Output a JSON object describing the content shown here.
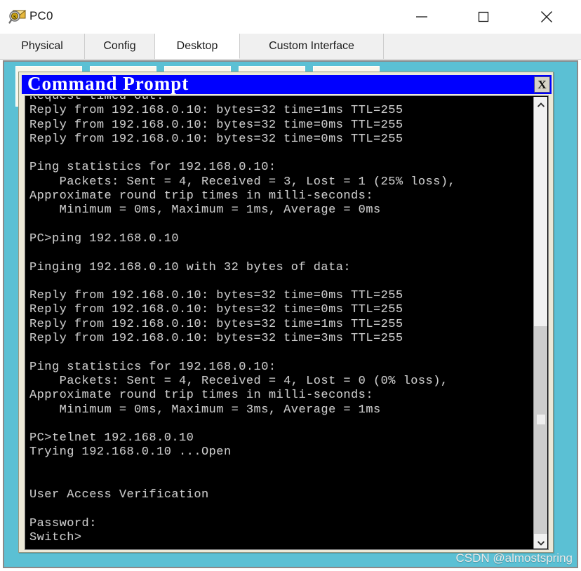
{
  "window": {
    "title": "PC0",
    "icon": "packet-tracer-device-icon",
    "controls": {
      "minimize_label": "—",
      "maximize_label": "□",
      "close_label": "✕"
    }
  },
  "tabs": [
    {
      "id": "physical",
      "label": "Physical",
      "active": false
    },
    {
      "id": "config",
      "label": "Config",
      "active": false
    },
    {
      "id": "desktop",
      "label": "Desktop",
      "active": true
    },
    {
      "id": "custom-interface",
      "label": "Custom Interface",
      "active": false
    }
  ],
  "desktop": {
    "background_color": "#5bc0d4",
    "tile_count": 5
  },
  "command_prompt": {
    "title": "Command Prompt",
    "close_label": "X",
    "titlebar_color": "#0000ff",
    "background_color": "#000000",
    "text_color": "#cccccc",
    "lines": [
      "Request timed out.",
      "Reply from 192.168.0.10: bytes=32 time=1ms TTL=255",
      "Reply from 192.168.0.10: bytes=32 time=0ms TTL=255",
      "Reply from 192.168.0.10: bytes=32 time=0ms TTL=255",
      "",
      "Ping statistics for 192.168.0.10:",
      "    Packets: Sent = 4, Received = 3, Lost = 1 (25% loss),",
      "Approximate round trip times in milli-seconds:",
      "    Minimum = 0ms, Maximum = 1ms, Average = 0ms",
      "",
      "PC>ping 192.168.0.10",
      "",
      "Pinging 192.168.0.10 with 32 bytes of data:",
      "",
      "Reply from 192.168.0.10: bytes=32 time=0ms TTL=255",
      "Reply from 192.168.0.10: bytes=32 time=0ms TTL=255",
      "Reply from 192.168.0.10: bytes=32 time=1ms TTL=255",
      "Reply from 192.168.0.10: bytes=32 time=3ms TTL=255",
      "",
      "Ping statistics for 192.168.0.10:",
      "    Packets: Sent = 4, Received = 4, Lost = 0 (0% loss),",
      "Approximate round trip times in milli-seconds:",
      "    Minimum = 0ms, Maximum = 3ms, Average = 1ms",
      "",
      "PC>telnet 192.168.0.10",
      "Trying 192.168.0.10 ...Open",
      "",
      "",
      "User Access Verification",
      "",
      "Password:",
      "Switch>"
    ],
    "scrollbar": {
      "up_arrow": "chevron-up",
      "down_arrow": "chevron-down"
    }
  },
  "watermark": {
    "text": "CSDN @almostspring"
  }
}
